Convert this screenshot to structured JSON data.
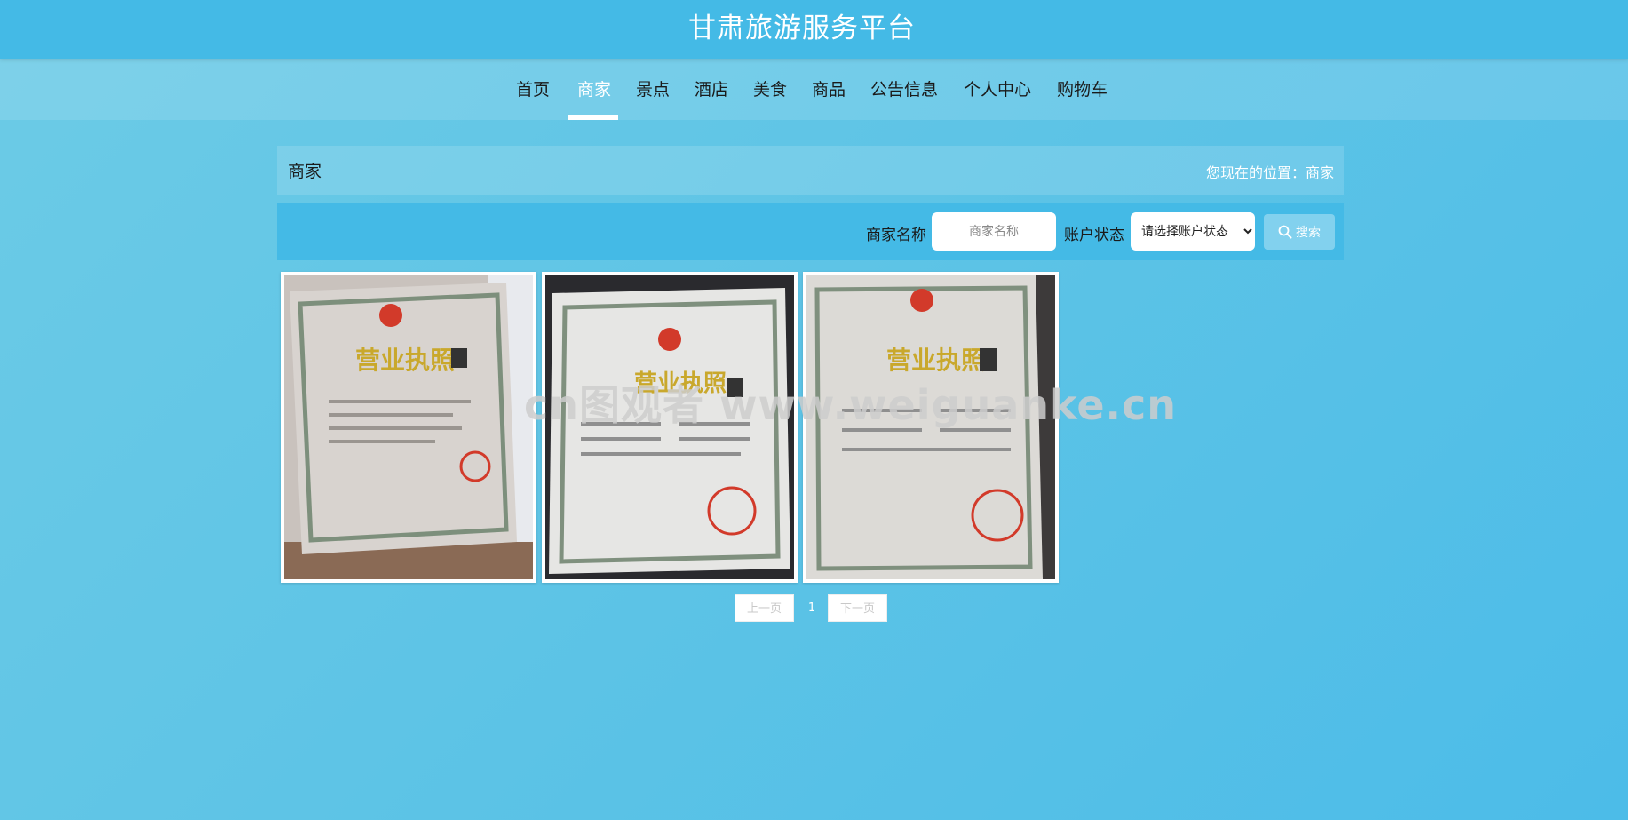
{
  "header": {
    "title": "甘肃旅游服务平台"
  },
  "nav": {
    "items": [
      {
        "label": "首页",
        "active": false
      },
      {
        "label": "商家",
        "active": true
      },
      {
        "label": "景点",
        "active": false
      },
      {
        "label": "酒店",
        "active": false
      },
      {
        "label": "美食",
        "active": false
      },
      {
        "label": "商品",
        "active": false
      },
      {
        "label": "公告信息",
        "active": false
      },
      {
        "label": "个人中心",
        "active": false
      },
      {
        "label": "购物车",
        "active": false
      }
    ]
  },
  "breadcrumb": {
    "title": "商家",
    "location": "您现在的位置：商家"
  },
  "search": {
    "name_label": "商家名称",
    "name_placeholder": "商家名称",
    "name_value": "",
    "status_label": "账户状态",
    "status_selected": "请选择账户状态",
    "button_label": "搜索"
  },
  "merchants": [
    {
      "image": "business-license-photo"
    },
    {
      "image": "business-license-photo"
    },
    {
      "image": "business-license-photo"
    }
  ],
  "watermark": "cn图观者 www.weiguanke.cn",
  "pagination": {
    "prev": "上一页",
    "current": "1",
    "next": "下一页"
  },
  "colors": {
    "header": "#44bae6",
    "accent": "#44bae6",
    "search_button": "#82d1ee"
  }
}
